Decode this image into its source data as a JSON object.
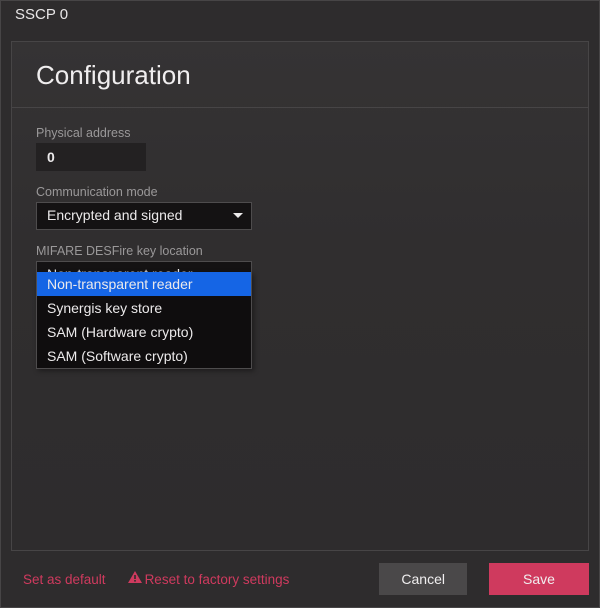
{
  "window": {
    "title": "SSCP 0"
  },
  "panel": {
    "title": "Configuration"
  },
  "fields": {
    "physical_address": {
      "label": "Physical address",
      "value": "0"
    },
    "communication_mode": {
      "label": "Communication mode",
      "value": "Encrypted and signed"
    },
    "key_location": {
      "label": "MIFARE DESFire key location",
      "value": "Non-transparent reader",
      "options": [
        "Non-transparent reader",
        "Synergis key store",
        "SAM (Hardware crypto)",
        "SAM (Software crypto)"
      ],
      "selected_index": 0
    }
  },
  "footer": {
    "set_default": "Set as default",
    "reset": "Reset to factory settings",
    "cancel": "Cancel",
    "save": "Save"
  },
  "colors": {
    "accent": "#cf3a5e",
    "select_highlight": "#1565e5"
  }
}
